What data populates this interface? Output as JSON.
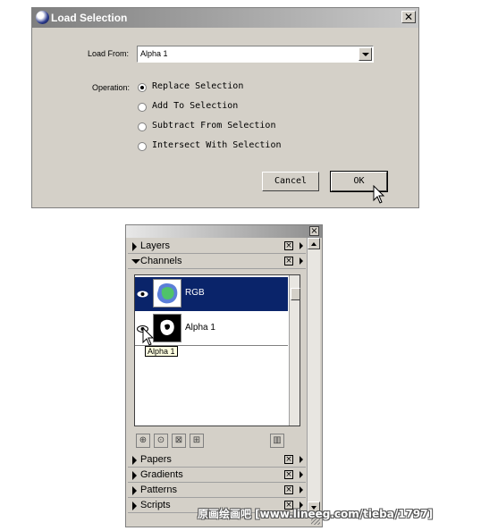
{
  "dialog": {
    "title": "Load Selection",
    "close_glyph": "✕",
    "load_from_label": "Load From:",
    "load_from_value": "Alpha 1",
    "operation_label": "Operation:",
    "options": [
      {
        "label": "Replace Selection",
        "checked": true
      },
      {
        "label": "Add To Selection",
        "checked": false
      },
      {
        "label": "Subtract From Selection",
        "checked": false
      },
      {
        "label": "Intersect With Selection",
        "checked": false
      }
    ],
    "cancel_label": "Cancel",
    "ok_label": "OK"
  },
  "palette": {
    "close_glyph": "×",
    "panels_top": [
      {
        "label": "Layers",
        "expanded": false
      },
      {
        "label": "Channels",
        "expanded": true
      }
    ],
    "channels": [
      {
        "name": "RGB",
        "selected": true
      },
      {
        "name": "Alpha 1",
        "selected": false
      }
    ],
    "tooltip": "Alpha 1",
    "panels_bottom": [
      {
        "label": "Papers"
      },
      {
        "label": "Gradients"
      },
      {
        "label": "Patterns"
      },
      {
        "label": "Scripts"
      }
    ],
    "panel_close_glyph": "×",
    "eye_glyph": "👁"
  },
  "watermark": "原画绘画吧 [www.lineeg.com/tieba/1797]",
  "colors": {
    "selection": "#0a246a",
    "face": "#d4d0c8"
  }
}
